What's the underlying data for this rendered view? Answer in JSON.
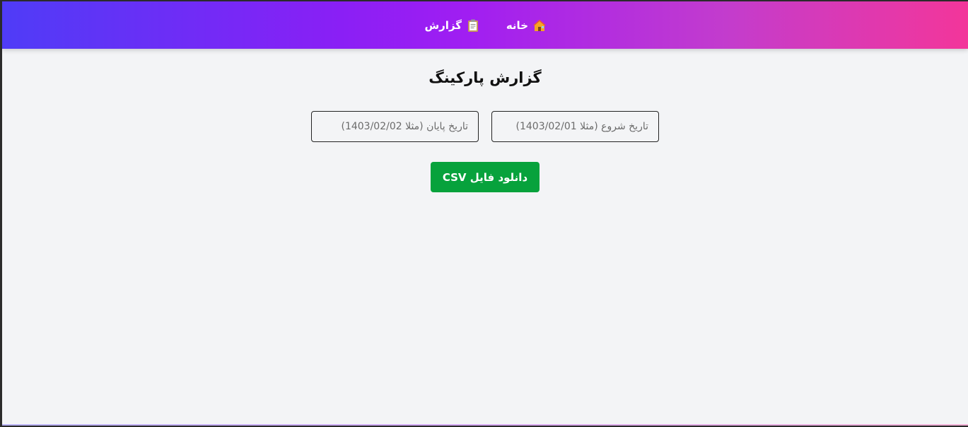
{
  "nav": {
    "items": [
      {
        "label": "خانه",
        "icon": "house-icon"
      },
      {
        "label": "گزارش",
        "icon": "clipboard-icon"
      }
    ],
    "gradient": [
      "#4f3cf7",
      "#a01ef2",
      "#f3369a"
    ]
  },
  "main": {
    "title": "گزارش پارکینگ",
    "start_date": {
      "value": "",
      "placeholder": "تاریخ شروع (مثلا 1403/02/01)"
    },
    "end_date": {
      "value": "",
      "placeholder": "تاریخ پایان (مثلا 1403/02/02)"
    },
    "download_label": "دانلود فایل CSV",
    "download_color": "#07a23c"
  }
}
